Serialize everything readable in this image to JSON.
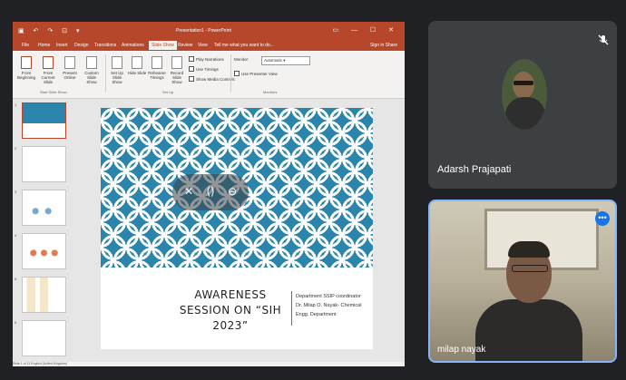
{
  "powerpoint": {
    "window_title": "Presentation1 - PowerPoint",
    "tabs": [
      "File",
      "Home",
      "Insert",
      "Design",
      "Transitions",
      "Animations",
      "Slide Show",
      "Review",
      "View"
    ],
    "active_tab": "Slide Show",
    "tell_me": "Tell me what you want to do...",
    "signin": "Sign in",
    "share": "Share",
    "ribbon": {
      "from_beginning": "From Beginning",
      "from_current": "From Current Slide",
      "present_online": "Present Online",
      "custom_show": "Custom Slide Show",
      "setup": "Set Up Slide Show",
      "hide_slide": "Hide Slide",
      "rehearse": "Rehearse Timings",
      "record": "Record Slide Show",
      "play_narrations": "Play Narrations",
      "use_timings": "Use Timings",
      "show_media_controls": "Show Media Controls",
      "monitor_label": "Monitor:",
      "monitor_value": "Automatic",
      "use_presenter_view": "Use Presenter View",
      "groups": [
        "Start Slide Show",
        "Set Up",
        "Monitors"
      ]
    },
    "slide": {
      "title": "AWARENESS SESSION ON “SIH 2023”",
      "info_lines": [
        "Department SSIP coordinator",
        "Dr. Milap O. Nayak- Chemical",
        "Engg. Department"
      ]
    },
    "status": "Slide 1 of 11  English (United Kingdom)"
  },
  "participants": [
    {
      "name": "Adarsh Prajapati",
      "muted": true
    },
    {
      "name": "milap nayak",
      "muted": false
    }
  ],
  "colors": {
    "ppt_red": "#b7472a",
    "slide_blue": "#2a84ab",
    "meet_bg": "#202124",
    "tile_bg": "#3c4043",
    "active_border": "#8ab4f8"
  }
}
